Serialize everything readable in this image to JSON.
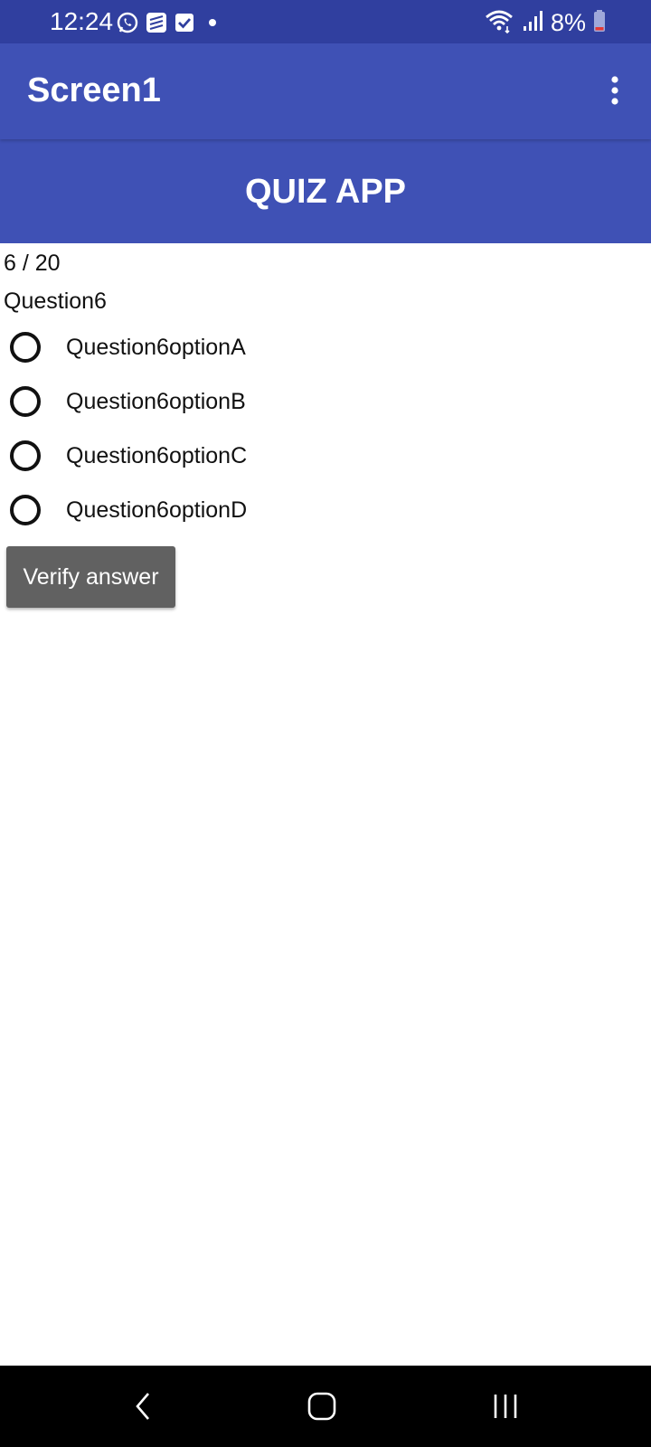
{
  "status_bar": {
    "time": "12:24",
    "battery_text": "8%",
    "left_icons": [
      "whatsapp-icon",
      "stack-app-icon",
      "checkbox-app-icon",
      "notification-dot-icon"
    ],
    "right_icons": [
      "wifi-icon",
      "signal-icon",
      "battery-icon"
    ]
  },
  "app_bar": {
    "title": "Screen1",
    "menu_icon": "more-vert-icon"
  },
  "quiz": {
    "header_title": "QUIZ APP",
    "progress": "6 / 20",
    "question": "Question6",
    "options": [
      {
        "label": "Question6optionA"
      },
      {
        "label": "Question6optionB"
      },
      {
        "label": "Question6optionC"
      },
      {
        "label": "Question6optionD"
      }
    ],
    "verify_label": "Verify answer"
  },
  "nav_bar": {
    "buttons": [
      "back-icon",
      "home-icon",
      "recents-icon"
    ]
  },
  "colors": {
    "status_bar": "#303f9f",
    "primary": "#3f51b5",
    "button": "#616161",
    "nav_bar": "#000000"
  }
}
